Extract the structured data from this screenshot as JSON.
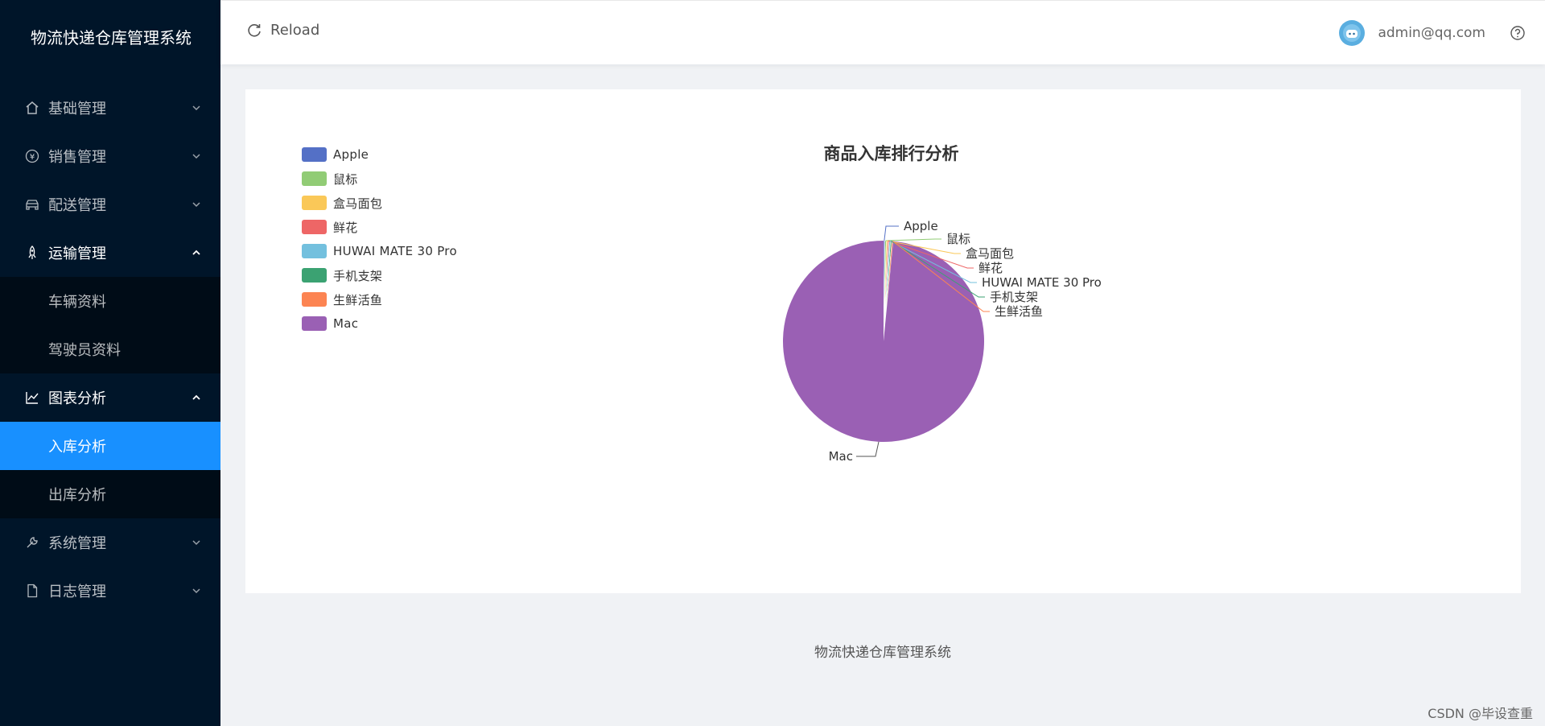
{
  "app": {
    "title": "物流快递仓库管理系统"
  },
  "sidebar": {
    "items": [
      {
        "label": "基础管理",
        "icon": "home-icon",
        "expanded": false
      },
      {
        "label": "销售管理",
        "icon": "yen-icon",
        "expanded": false
      },
      {
        "label": "配送管理",
        "icon": "car-icon",
        "expanded": false
      },
      {
        "label": "运输管理",
        "icon": "rocket-icon",
        "expanded": true,
        "children": [
          {
            "label": "车辆资料"
          },
          {
            "label": "驾驶员资料"
          }
        ]
      },
      {
        "label": "图表分析",
        "icon": "line-chart-icon",
        "expanded": true,
        "children": [
          {
            "label": "入库分析",
            "active": true
          },
          {
            "label": "出库分析"
          }
        ]
      },
      {
        "label": "系统管理",
        "icon": "tool-icon",
        "expanded": false
      },
      {
        "label": "日志管理",
        "icon": "file-icon",
        "expanded": false
      }
    ]
  },
  "header": {
    "reload_label": "Reload",
    "user_email": "admin@qq.com"
  },
  "chart_data": {
    "type": "pie",
    "title": "商品入库排行分析",
    "legend_position": "top-left",
    "slices": [
      {
        "name": "Apple",
        "value": 1,
        "color": "#5470c6"
      },
      {
        "name": "鼠标",
        "value": 1,
        "color": "#91cc75"
      },
      {
        "name": "盒马面包",
        "value": 1,
        "color": "#fac858"
      },
      {
        "name": "鲜花",
        "value": 1,
        "color": "#ee6666"
      },
      {
        "name": "HUWAI MATE 30 Pro",
        "value": 1,
        "color": "#73c0de"
      },
      {
        "name": "手机支架",
        "value": 1,
        "color": "#3ba272"
      },
      {
        "name": "生鲜活鱼",
        "value": 1,
        "color": "#fc8452"
      },
      {
        "name": "Mac",
        "value": 450,
        "color": "#9a60b4"
      }
    ]
  },
  "footer": {
    "text": "物流快递仓库管理系统"
  },
  "watermark": "CSDN @毕设查重"
}
